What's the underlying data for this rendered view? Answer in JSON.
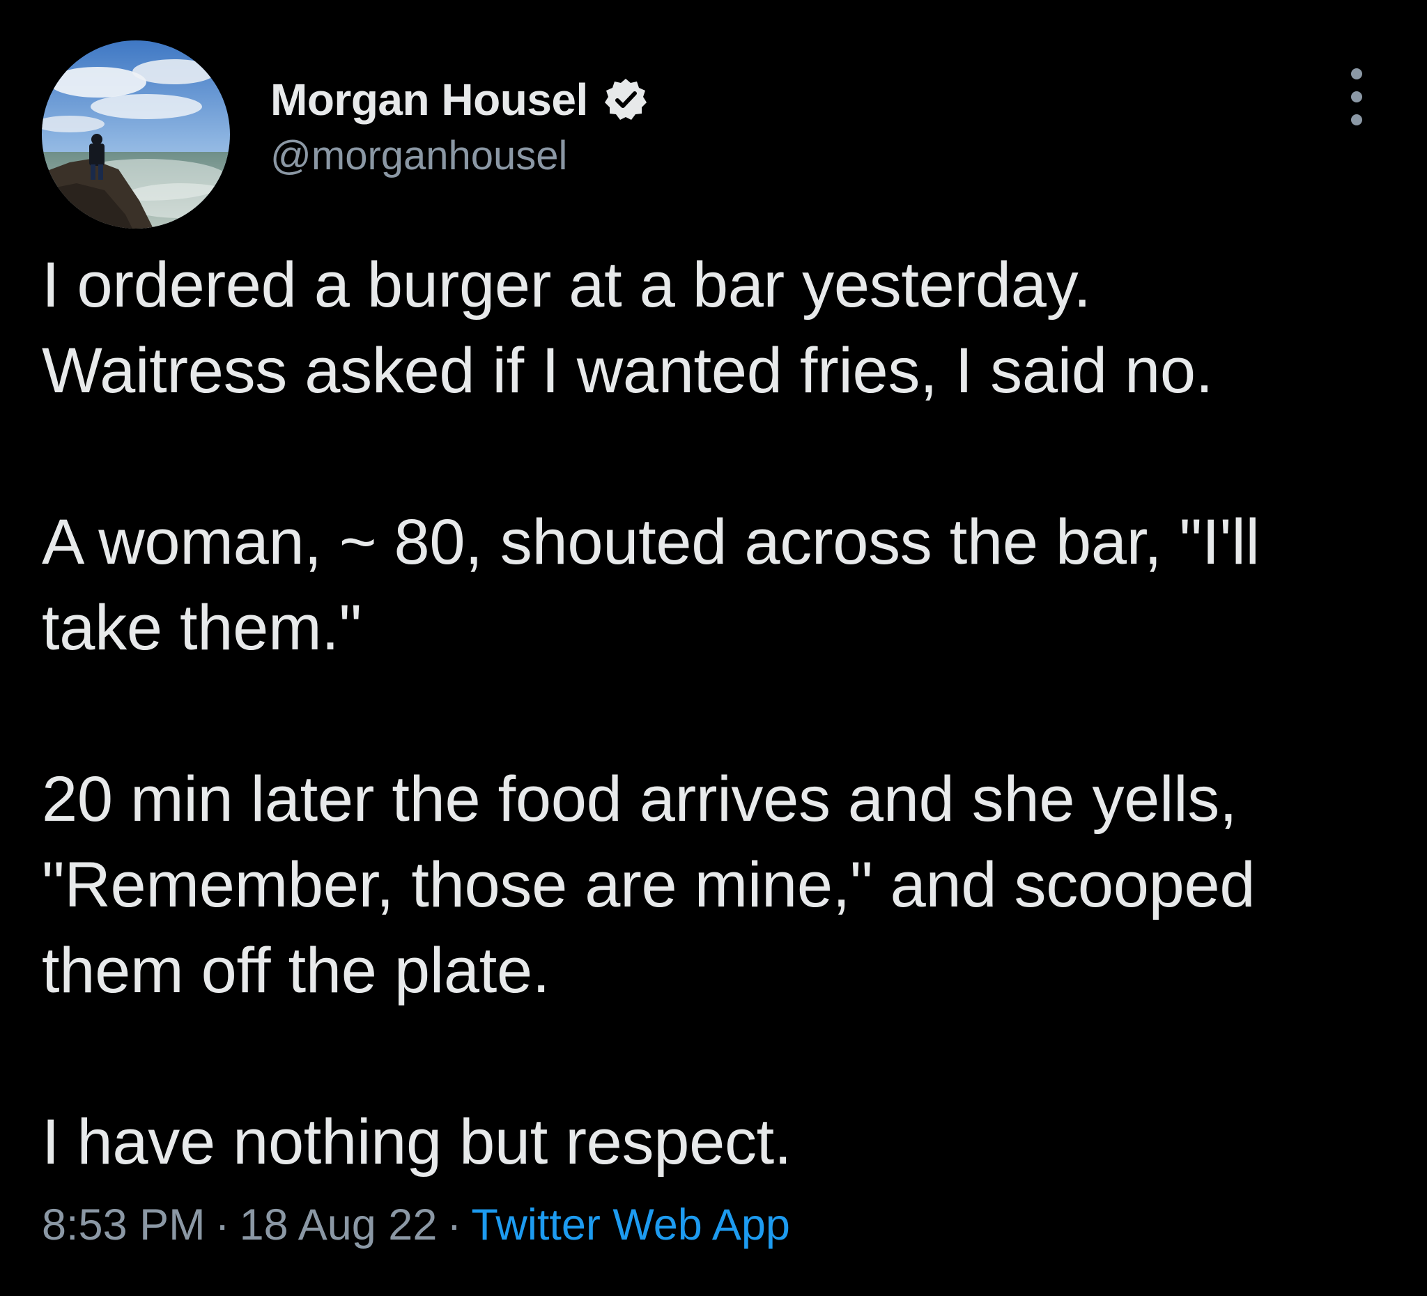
{
  "author": {
    "display_name": "Morgan Housel",
    "handle": "@morganhousel",
    "verified": true,
    "avatar_icon": "profile-photo-person-on-rocks-by-sea"
  },
  "menu": {
    "icon": "more-vertical-icon"
  },
  "tweet": {
    "paragraphs": [
      "I ordered a burger at a bar yesterday.\nWaitress asked if I wanted fries, I said no.",
      "A woman, ~ 80, shouted across the bar, \"I'll\ntake them.\"",
      "20 min later the food arrives and she yells,\n\"Remember, those are mine,\" and scooped\nthem off the plate.",
      "I have nothing but respect."
    ]
  },
  "meta": {
    "time": "8:53 PM",
    "separator": "·",
    "date": "18 Aug 22",
    "source": "Twitter Web App"
  },
  "colors": {
    "background": "#000000",
    "text_primary": "#e7e9ea",
    "text_secondary": "#8b98a5",
    "link": "#1d9bf0"
  }
}
